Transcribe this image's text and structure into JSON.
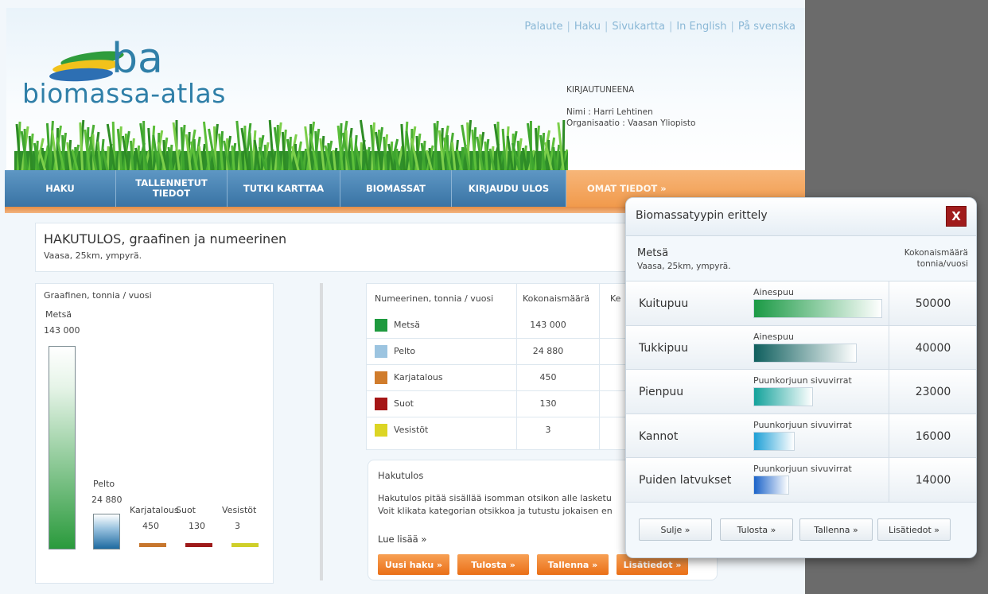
{
  "header": {
    "top_links": [
      "Palaute",
      "Haku",
      "Sivukartta",
      "In English",
      "På svenska"
    ],
    "logo_ba": "ba",
    "logo_text": "biomassa-atlas",
    "user": {
      "status": "KIRJAUTUNEENA",
      "name": "Nimi : Harri Lehtinen",
      "org": "Organisaatio : Vaasan Yliopisto"
    }
  },
  "nav": [
    {
      "label": "HAKU"
    },
    {
      "label": "TALLENNETUT TIEDOT"
    },
    {
      "label": "TUTKI KARTTAA"
    },
    {
      "label": "BIOMASSAT"
    },
    {
      "label": "KIRJAUDU ULOS"
    },
    {
      "label": "OMAT TIEDOT »",
      "active": true
    }
  ],
  "result": {
    "title": "HAKUTULOS, graafinen ja numeerinen",
    "subtitle": "Vaasa, 25km, ympyrä."
  },
  "chart_data": {
    "type": "bar",
    "title": "Graafinen, tonnia / vuosi",
    "categories": [
      "Metsä",
      "Pelto",
      "Karjatalous",
      "Suot",
      "Vesistöt"
    ],
    "values": [
      143000,
      24880,
      450,
      130,
      3
    ],
    "value_labels": [
      "143 000",
      "24 880",
      "450",
      "130",
      "3"
    ],
    "colors": [
      "#2a9a3c",
      "#1e6aa0",
      "#c7762d",
      "#9e1a1a",
      "#cfcf2a"
    ]
  },
  "table": {
    "header": "Numeerinen, tonnia / vuosi",
    "col_total": "Kokonaismäärä",
    "col_third": "Ke",
    "rows": [
      {
        "name": "Metsä",
        "value": "143 000",
        "color": "#1e9a3e"
      },
      {
        "name": "Pelto",
        "value": "24 880",
        "color": "#9cc4e0"
      },
      {
        "name": "Karjatalous",
        "value": "450",
        "color": "#d07c2c"
      },
      {
        "name": "Suot",
        "value": "130",
        "color": "#a51616"
      },
      {
        "name": "Vesistöt",
        "value": "3",
        "color": "#dcd524"
      }
    ]
  },
  "hakutulos": {
    "title": "Hakutulos",
    "line1": "Hakutulos pitää sisällää isomman otsikon alle lasketu",
    "line2": "Voit klikata kategorian otsikkoa ja tutustu jokaisen en",
    "more": "Lue lisää »",
    "buttons": [
      "Uusi haku »",
      "Tulosta »",
      "Tallenna »",
      "Lisätiedot »"
    ]
  },
  "dialog": {
    "title": "Biomassatyypin erittely",
    "close": "X",
    "category": "Metsä",
    "category_sub": "Vaasa, 25km, ympyrä.",
    "total_header_1": "Kokonaismäärä",
    "total_header_2": "tonnia/vuosi",
    "rows": [
      {
        "name": "Kuitupuu",
        "type": "Ainespuu",
        "value": "50000",
        "level": 1.0,
        "color_from": "#1b9a45",
        "color_to": "#ffffff"
      },
      {
        "name": "Tukkipuu",
        "type": "Ainespuu",
        "value": "40000",
        "level": 0.8,
        "color_from": "#0f5f5e",
        "color_to": "#ffffff"
      },
      {
        "name": "Pienpuu",
        "type": "Puunkorjuun sivuvirrat",
        "value": "23000",
        "level": 0.46,
        "color_from": "#13a29b",
        "color_to": "#ffffff"
      },
      {
        "name": "Kannot",
        "type": "Puunkorjuun sivuvirrat",
        "value": "16000",
        "level": 0.32,
        "color_from": "#1d9fd6",
        "color_to": "#ffffff"
      },
      {
        "name": "Puiden latvukset",
        "type": "Puunkorjuun sivuvirrat",
        "value": "14000",
        "level": 0.28,
        "color_from": "#1b63c9",
        "color_to": "#ffffff"
      }
    ],
    "buttons": [
      "Sulje »",
      "Tulosta »",
      "Tallenna »",
      "Lisätiedot »"
    ]
  }
}
